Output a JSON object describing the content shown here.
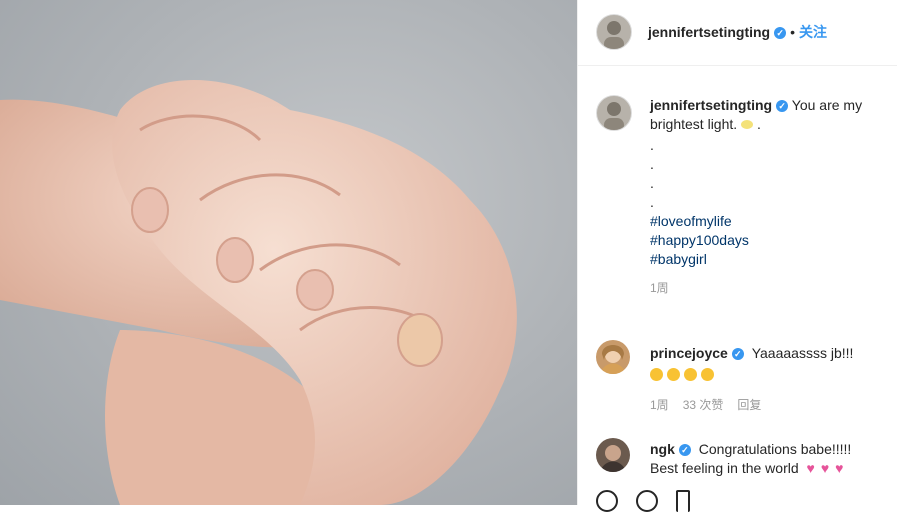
{
  "header": {
    "username": "jennifertsetingting",
    "separator": "•",
    "follow_label": "关注"
  },
  "caption": {
    "username": "jennifertsetingting",
    "text": "You are my brightest light.",
    "tail": ".",
    "dots": [
      ".",
      ".",
      ".",
      "."
    ],
    "hashtags": [
      "#loveofmylife",
      "#happy100days",
      "#babygirl"
    ],
    "meta": "1周"
  },
  "comments": [
    {
      "username": "princejoyce",
      "text": "Yaaaaassss jb!!!",
      "meta_time": "1周",
      "meta_likes": "33 次赞",
      "meta_reply": "回复"
    },
    {
      "username": "ngk",
      "text": "Congratulations babe!!!!!",
      "text2": "Best feeling in the world"
    }
  ],
  "icons": {
    "verified": "verified-badge-icon",
    "smile": "smiling-face-with-heart-eyes-icon",
    "heart": "sparkling-heart-icon"
  },
  "colors": {
    "accent": "#3897f0",
    "hashtag": "#003569",
    "meta": "#999999"
  }
}
